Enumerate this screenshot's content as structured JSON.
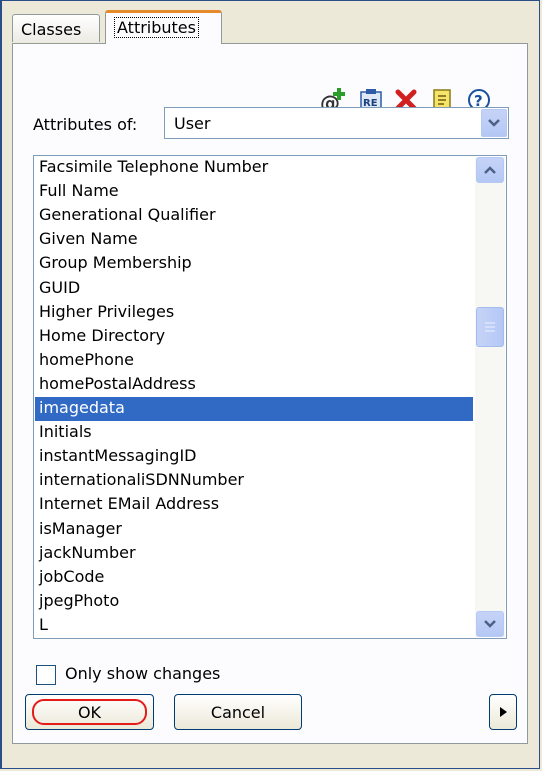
{
  "tabs": [
    {
      "label": "Classes",
      "active": false
    },
    {
      "label": "Attributes",
      "active": true
    }
  ],
  "toolbar": {
    "icons": [
      "add-attribute-icon",
      "regex-icon",
      "delete-icon",
      "notes-icon",
      "help-icon"
    ]
  },
  "attributes_of": {
    "label": "Attributes of:",
    "value": "User"
  },
  "list": {
    "items": [
      "Facsimile Telephone Number",
      "Full Name",
      "Generational Qualifier",
      "Given Name",
      "Group Membership",
      "GUID",
      "Higher Privileges",
      "Home Directory",
      "homePhone",
      "homePostalAddress",
      "imagedata",
      "Initials",
      "instantMessagingID",
      "internationaliSDNNumber",
      "Internet EMail Address",
      "isManager",
      "jackNumber",
      "jobCode",
      "jpegPhoto",
      "L"
    ],
    "selected_index": 10
  },
  "only_show_changes": {
    "label": "Only show changes",
    "checked": false
  },
  "buttons": {
    "ok": "OK",
    "cancel": "Cancel"
  },
  "colors": {
    "selection": "#316ac5",
    "tab_highlight": "#e68b2c",
    "ok_outline": "#e31b1b"
  }
}
